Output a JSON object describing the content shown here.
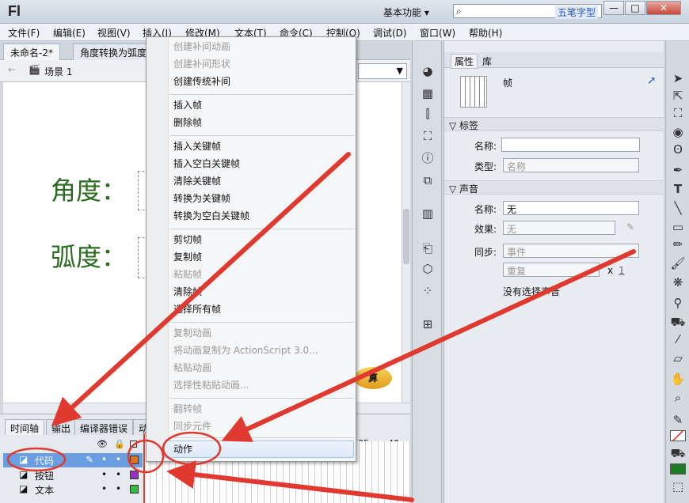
{
  "titlebar": {
    "logo": "Fl",
    "workspace": "基本功能",
    "workspace_caret": "▾",
    "search_placeholder": "",
    "watermark": "五笔字型",
    "min": "—",
    "max": "□",
    "close": "✕"
  },
  "menu": [
    "文件(F)",
    "编辑(E)",
    "视图(V)",
    "插入(I)",
    "修改(M)",
    "文本(T)",
    "命令(C)",
    "控制(O)",
    "调试(D)",
    "窗口(W)",
    "帮助(H)"
  ],
  "doc_tabs": [
    "未命名-2*",
    "角度转换为弧度"
  ],
  "scene": {
    "label": "场景 1"
  },
  "stage": {
    "angle_label": "角度：",
    "radian_label": "弧度：",
    "button_text": "算"
  },
  "timeline": {
    "tabs": [
      "时间轴",
      "输出",
      "编译器错误",
      "动"
    ],
    "ruler": [
      "35",
      "40"
    ],
    "layers": [
      {
        "name": "代码",
        "color": "#e07020",
        "selected": true
      },
      {
        "name": "按钮",
        "color": "#9b30c8",
        "selected": false
      },
      {
        "name": "文本",
        "color": "#30c040",
        "selected": false
      }
    ]
  },
  "context_menu": {
    "groups": [
      [
        {
          "label": "创建补间动画",
          "enabled": false
        },
        {
          "label": "创建补间形状",
          "enabled": false
        },
        {
          "label": "创建传统补间",
          "enabled": true
        }
      ],
      [
        {
          "label": "插入帧",
          "enabled": true
        },
        {
          "label": "删除帧",
          "enabled": true
        }
      ],
      [
        {
          "label": "插入关键帧",
          "enabled": true
        },
        {
          "label": "插入空白关键帧",
          "enabled": true
        },
        {
          "label": "清除关键帧",
          "enabled": true
        },
        {
          "label": "转换为关键帧",
          "enabled": true
        },
        {
          "label": "转换为空白关键帧",
          "enabled": true
        }
      ],
      [
        {
          "label": "剪切帧",
          "enabled": true
        },
        {
          "label": "复制帧",
          "enabled": true
        },
        {
          "label": "粘贴帧",
          "enabled": false
        },
        {
          "label": "清除帧",
          "enabled": true
        },
        {
          "label": "选择所有帧",
          "enabled": true
        }
      ],
      [
        {
          "label": "复制动画",
          "enabled": false
        },
        {
          "label": "将动画复制为 ActionScript 3.0...",
          "enabled": false
        },
        {
          "label": "粘贴动画",
          "enabled": false
        },
        {
          "label": "选择性粘贴动画...",
          "enabled": false
        }
      ],
      [
        {
          "label": "翻转帧",
          "enabled": false
        },
        {
          "label": "同步元件",
          "enabled": false
        }
      ],
      [
        {
          "label": "动作",
          "enabled": true,
          "highlighted": true
        }
      ]
    ]
  },
  "properties": {
    "tabs": [
      "属性",
      "库"
    ],
    "type": "帧",
    "label_section": "标签",
    "name_label": "名称:",
    "name_value": "",
    "type_label": "类型:",
    "type_value": "名称",
    "sound_section": "声音",
    "sound_name_label": "名称:",
    "sound_name_value": "无",
    "effect_label": "效果:",
    "effect_value": "无",
    "sync_label": "同步:",
    "sync_value": "事件",
    "repeat_value": "重复",
    "repeat_x": "x",
    "repeat_count": "1",
    "no_sound": "没有选择声音"
  },
  "colors": {
    "accent": "#e03a30",
    "stage_text": "#2a6a1f",
    "selection": "#6a9ee0"
  }
}
